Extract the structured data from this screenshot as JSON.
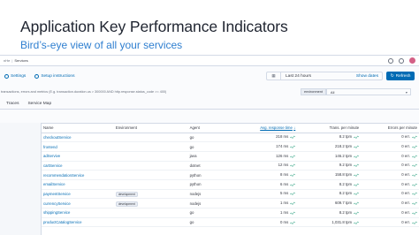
{
  "slide": {
    "title": "Application Key Performance Indicators",
    "subtitle": "Bird’s-eye view of all your services"
  },
  "topnav": {
    "crumbs": [
      "nHe",
      "Services"
    ]
  },
  "toolbar": {
    "settings_label": "Settings",
    "setup_label": "Setup instructions",
    "date_range": "Last 24 hours",
    "show_dates": "Show dates",
    "refresh_label": "Refresh"
  },
  "filter": {
    "kql_placeholder": "transactions, errors and metrics (E.g. transaction.duration.us > 300000 AND http.response.status_code >= 400)",
    "env_label": "environment",
    "env_value": "All"
  },
  "tabs": [
    {
      "label": "Traces"
    },
    {
      "label": "Service Map"
    }
  ],
  "table": {
    "headers": [
      "Name",
      "Environment",
      "Agent",
      "Avg. response time",
      "Trans. per minute",
      "Errors per minute"
    ],
    "rows": [
      {
        "name": "checkoutService",
        "env": "",
        "agent": "go",
        "avg": "218 ms",
        "tpm": "8.2 tpm",
        "epm": "0 err."
      },
      {
        "name": "frontend",
        "env": "",
        "agent": "go",
        "avg": "174 ms",
        "tpm": "218.2 tpm",
        "epm": "0 err."
      },
      {
        "name": "adServive",
        "env": "",
        "agent": "java",
        "avg": "126 ms",
        "tpm": "146.2 tpm",
        "epm": "0 err."
      },
      {
        "name": "cartService",
        "env": "",
        "agent": "dotnet",
        "avg": "12 ms",
        "tpm": "9.2 tpm",
        "epm": "0 err."
      },
      {
        "name": "recommendationService",
        "env": "",
        "agent": "python",
        "avg": "8 ms",
        "tpm": "158.8 tpm",
        "epm": "0 err."
      },
      {
        "name": "emailService",
        "env": "",
        "agent": "python",
        "avg": "6 ms",
        "tpm": "8.2 tpm",
        "epm": "0 err."
      },
      {
        "name": "paymentService",
        "env": "development",
        "agent": "nodejs",
        "avg": "5 ms",
        "tpm": "8.2 tpm",
        "epm": "0 err."
      },
      {
        "name": "currencyService",
        "env": "development",
        "agent": "nodejs",
        "avg": "1 ms",
        "tpm": "609.7 tpm",
        "epm": "0 err."
      },
      {
        "name": "shippingService",
        "env": "",
        "agent": "go",
        "avg": "1 ms",
        "tpm": "8.2 tpm",
        "epm": "0 err."
      },
      {
        "name": "productCatalogService",
        "env": "",
        "agent": "go",
        "avg": "0 ms",
        "tpm": "1,031.8 tpm",
        "epm": "0 err."
      }
    ]
  },
  "colors": {
    "title": "#1f2430",
    "subtitle": "#2f7fd0",
    "link": "#006bb4",
    "button": "#006bb4",
    "spark": "#54b399"
  }
}
